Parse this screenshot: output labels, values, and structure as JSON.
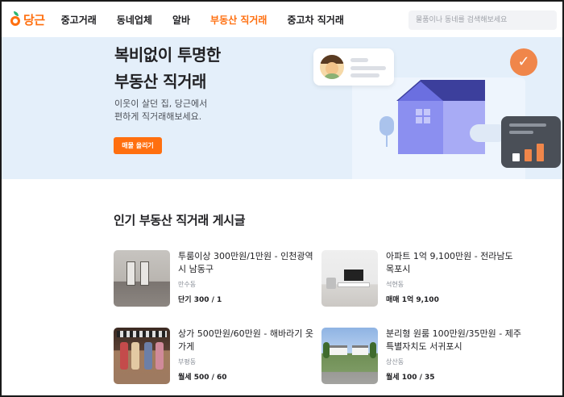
{
  "header": {
    "logo_text": "당근",
    "nav": [
      "중고거래",
      "동네업체",
      "알바",
      "부동산 직거래",
      "중고차 직거래"
    ],
    "active_nav": "부동산 직거래",
    "search_placeholder": "물품이나 동네를 검색해보세요"
  },
  "hero": {
    "title_line1": "복비없이 투명한",
    "title_line2": "부동산 직거래",
    "desc_line1": "이웃이 살던 집, 당근에서",
    "desc_line2": "편하게 직거래해보세요.",
    "cta_label": "매물 올리기"
  },
  "colors": {
    "brand": "#ff6f0f",
    "hero_bg": "#e4effa",
    "house": "#8b8ff0"
  },
  "section": {
    "title": "인기 부동산 직거래 게시글"
  },
  "listings": [
    {
      "title": "투룸이상 300만원/1만원 - 인천광역시 남동구",
      "region": "만수동",
      "price": "단기 300 / 1"
    },
    {
      "title": "아파트 1억 9,100만원 - 전라남도 목포시",
      "region": "석현동",
      "price": "매매 1억 9,100"
    },
    {
      "title": "상가 500만원/60만원 - 해바라기 옷가게",
      "region": "부평동",
      "price": "월세 500 / 60"
    },
    {
      "title": "분리형 원룸 100만원/35만원 - 제주특별자치도 서귀포시",
      "region": "상산동",
      "price": "월세 100 / 35"
    }
  ]
}
